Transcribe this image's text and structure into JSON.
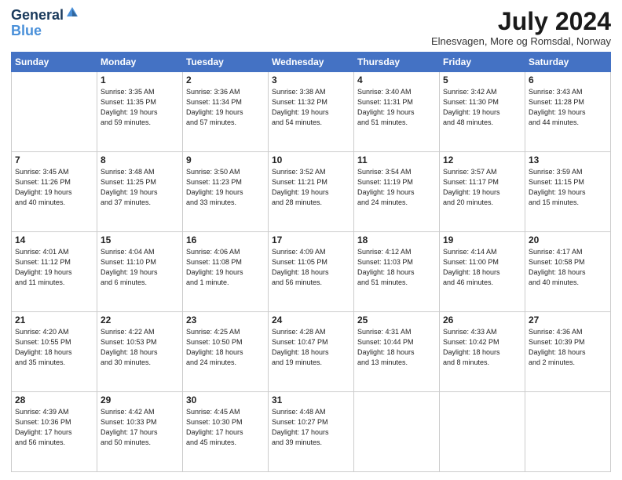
{
  "logo": {
    "line1": "General",
    "line2": "Blue"
  },
  "title": "July 2024",
  "location": "Elnesvagen, More og Romsdal, Norway",
  "days_of_week": [
    "Sunday",
    "Monday",
    "Tuesday",
    "Wednesday",
    "Thursday",
    "Friday",
    "Saturday"
  ],
  "weeks": [
    [
      {
        "day": "",
        "info": ""
      },
      {
        "day": "1",
        "info": "Sunrise: 3:35 AM\nSunset: 11:35 PM\nDaylight: 19 hours\nand 59 minutes."
      },
      {
        "day": "2",
        "info": "Sunrise: 3:36 AM\nSunset: 11:34 PM\nDaylight: 19 hours\nand 57 minutes."
      },
      {
        "day": "3",
        "info": "Sunrise: 3:38 AM\nSunset: 11:32 PM\nDaylight: 19 hours\nand 54 minutes."
      },
      {
        "day": "4",
        "info": "Sunrise: 3:40 AM\nSunset: 11:31 PM\nDaylight: 19 hours\nand 51 minutes."
      },
      {
        "day": "5",
        "info": "Sunrise: 3:42 AM\nSunset: 11:30 PM\nDaylight: 19 hours\nand 48 minutes."
      },
      {
        "day": "6",
        "info": "Sunrise: 3:43 AM\nSunset: 11:28 PM\nDaylight: 19 hours\nand 44 minutes."
      }
    ],
    [
      {
        "day": "7",
        "info": "Sunrise: 3:45 AM\nSunset: 11:26 PM\nDaylight: 19 hours\nand 40 minutes."
      },
      {
        "day": "8",
        "info": "Sunrise: 3:48 AM\nSunset: 11:25 PM\nDaylight: 19 hours\nand 37 minutes."
      },
      {
        "day": "9",
        "info": "Sunrise: 3:50 AM\nSunset: 11:23 PM\nDaylight: 19 hours\nand 33 minutes."
      },
      {
        "day": "10",
        "info": "Sunrise: 3:52 AM\nSunset: 11:21 PM\nDaylight: 19 hours\nand 28 minutes."
      },
      {
        "day": "11",
        "info": "Sunrise: 3:54 AM\nSunset: 11:19 PM\nDaylight: 19 hours\nand 24 minutes."
      },
      {
        "day": "12",
        "info": "Sunrise: 3:57 AM\nSunset: 11:17 PM\nDaylight: 19 hours\nand 20 minutes."
      },
      {
        "day": "13",
        "info": "Sunrise: 3:59 AM\nSunset: 11:15 PM\nDaylight: 19 hours\nand 15 minutes."
      }
    ],
    [
      {
        "day": "14",
        "info": "Sunrise: 4:01 AM\nSunset: 11:12 PM\nDaylight: 19 hours\nand 11 minutes."
      },
      {
        "day": "15",
        "info": "Sunrise: 4:04 AM\nSunset: 11:10 PM\nDaylight: 19 hours\nand 6 minutes."
      },
      {
        "day": "16",
        "info": "Sunrise: 4:06 AM\nSunset: 11:08 PM\nDaylight: 19 hours\nand 1 minute."
      },
      {
        "day": "17",
        "info": "Sunrise: 4:09 AM\nSunset: 11:05 PM\nDaylight: 18 hours\nand 56 minutes."
      },
      {
        "day": "18",
        "info": "Sunrise: 4:12 AM\nSunset: 11:03 PM\nDaylight: 18 hours\nand 51 minutes."
      },
      {
        "day": "19",
        "info": "Sunrise: 4:14 AM\nSunset: 11:00 PM\nDaylight: 18 hours\nand 46 minutes."
      },
      {
        "day": "20",
        "info": "Sunrise: 4:17 AM\nSunset: 10:58 PM\nDaylight: 18 hours\nand 40 minutes."
      }
    ],
    [
      {
        "day": "21",
        "info": "Sunrise: 4:20 AM\nSunset: 10:55 PM\nDaylight: 18 hours\nand 35 minutes."
      },
      {
        "day": "22",
        "info": "Sunrise: 4:22 AM\nSunset: 10:53 PM\nDaylight: 18 hours\nand 30 minutes."
      },
      {
        "day": "23",
        "info": "Sunrise: 4:25 AM\nSunset: 10:50 PM\nDaylight: 18 hours\nand 24 minutes."
      },
      {
        "day": "24",
        "info": "Sunrise: 4:28 AM\nSunset: 10:47 PM\nDaylight: 18 hours\nand 19 minutes."
      },
      {
        "day": "25",
        "info": "Sunrise: 4:31 AM\nSunset: 10:44 PM\nDaylight: 18 hours\nand 13 minutes."
      },
      {
        "day": "26",
        "info": "Sunrise: 4:33 AM\nSunset: 10:42 PM\nDaylight: 18 hours\nand 8 minutes."
      },
      {
        "day": "27",
        "info": "Sunrise: 4:36 AM\nSunset: 10:39 PM\nDaylight: 18 hours\nand 2 minutes."
      }
    ],
    [
      {
        "day": "28",
        "info": "Sunrise: 4:39 AM\nSunset: 10:36 PM\nDaylight: 17 hours\nand 56 minutes."
      },
      {
        "day": "29",
        "info": "Sunrise: 4:42 AM\nSunset: 10:33 PM\nDaylight: 17 hours\nand 50 minutes."
      },
      {
        "day": "30",
        "info": "Sunrise: 4:45 AM\nSunset: 10:30 PM\nDaylight: 17 hours\nand 45 minutes."
      },
      {
        "day": "31",
        "info": "Sunrise: 4:48 AM\nSunset: 10:27 PM\nDaylight: 17 hours\nand 39 minutes."
      },
      {
        "day": "",
        "info": ""
      },
      {
        "day": "",
        "info": ""
      },
      {
        "day": "",
        "info": ""
      }
    ]
  ]
}
